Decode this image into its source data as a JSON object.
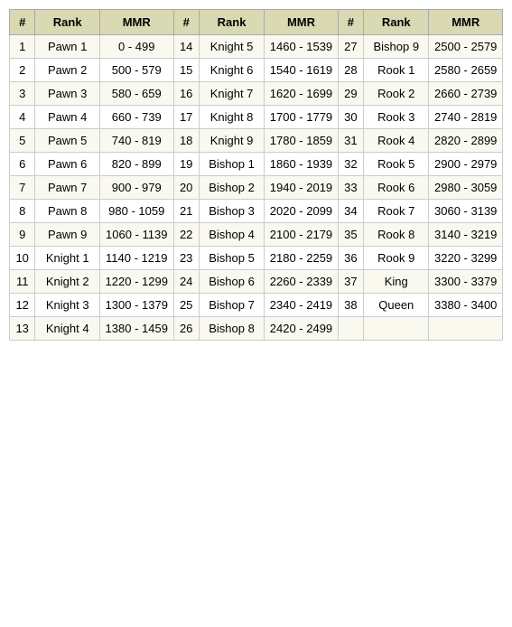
{
  "table": {
    "headers": [
      {
        "label": "#"
      },
      {
        "label": "Rank"
      },
      {
        "label": "MMR"
      },
      {
        "label": "#"
      },
      {
        "label": "Rank"
      },
      {
        "label": "MMR"
      },
      {
        "label": "#"
      },
      {
        "label": "Rank"
      },
      {
        "label": "MMR"
      }
    ],
    "rows": [
      {
        "n1": "1",
        "r1": "Pawn 1",
        "m1": "0 - 499",
        "n2": "14",
        "r2": "Knight 5",
        "m2": "1460 - 1539",
        "n3": "27",
        "r3": "Bishop 9",
        "m3": "2500 - 2579"
      },
      {
        "n1": "2",
        "r1": "Pawn 2",
        "m1": "500 - 579",
        "n2": "15",
        "r2": "Knight 6",
        "m2": "1540 - 1619",
        "n3": "28",
        "r3": "Rook 1",
        "m3": "2580 - 2659"
      },
      {
        "n1": "3",
        "r1": "Pawn 3",
        "m1": "580 - 659",
        "n2": "16",
        "r2": "Knight 7",
        "m2": "1620 - 1699",
        "n3": "29",
        "r3": "Rook 2",
        "m3": "2660 - 2739"
      },
      {
        "n1": "4",
        "r1": "Pawn 4",
        "m1": "660 - 739",
        "n2": "17",
        "r2": "Knight 8",
        "m2": "1700 - 1779",
        "n3": "30",
        "r3": "Rook 3",
        "m3": "2740 - 2819"
      },
      {
        "n1": "5",
        "r1": "Pawn 5",
        "m1": "740 - 819",
        "n2": "18",
        "r2": "Knight 9",
        "m2": "1780 - 1859",
        "n3": "31",
        "r3": "Rook 4",
        "m3": "2820 - 2899"
      },
      {
        "n1": "6",
        "r1": "Pawn 6",
        "m1": "820 - 899",
        "n2": "19",
        "r2": "Bishop 1",
        "m2": "1860 - 1939",
        "n3": "32",
        "r3": "Rook 5",
        "m3": "2900 - 2979"
      },
      {
        "n1": "7",
        "r1": "Pawn 7",
        "m1": "900 - 979",
        "n2": "20",
        "r2": "Bishop 2",
        "m2": "1940 - 2019",
        "n3": "33",
        "r3": "Rook 6",
        "m3": "2980 - 3059"
      },
      {
        "n1": "8",
        "r1": "Pawn 8",
        "m1": "980 - 1059",
        "n2": "21",
        "r2": "Bishop 3",
        "m2": "2020 - 2099",
        "n3": "34",
        "r3": "Rook 7",
        "m3": "3060 - 3139"
      },
      {
        "n1": "9",
        "r1": "Pawn 9",
        "m1": "1060 - 1139",
        "n2": "22",
        "r2": "Bishop 4",
        "m2": "2100 - 2179",
        "n3": "35",
        "r3": "Rook 8",
        "m3": "3140 - 3219"
      },
      {
        "n1": "10",
        "r1": "Knight 1",
        "m1": "1140 - 1219",
        "n2": "23",
        "r2": "Bishop 5",
        "m2": "2180 - 2259",
        "n3": "36",
        "r3": "Rook 9",
        "m3": "3220 - 3299"
      },
      {
        "n1": "11",
        "r1": "Knight 2",
        "m1": "1220 - 1299",
        "n2": "24",
        "r2": "Bishop 6",
        "m2": "2260 - 2339",
        "n3": "37",
        "r3": "King",
        "m3": "3300 - 3379"
      },
      {
        "n1": "12",
        "r1": "Knight 3",
        "m1": "1300 - 1379",
        "n2": "25",
        "r2": "Bishop 7",
        "m2": "2340 - 2419",
        "n3": "38",
        "r3": "Queen",
        "m3": "3380 - 3400"
      },
      {
        "n1": "13",
        "r1": "Knight 4",
        "m1": "1380 - 1459",
        "n2": "26",
        "r2": "Bishop 8",
        "m2": "2420 - 2499",
        "n3": "",
        "r3": "",
        "m3": ""
      }
    ]
  }
}
